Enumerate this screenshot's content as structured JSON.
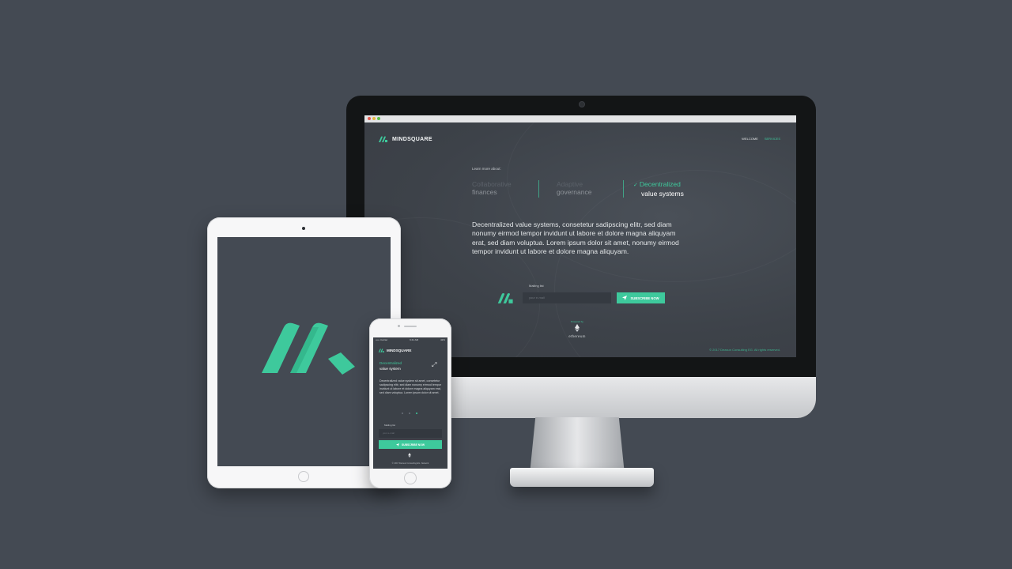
{
  "brand": {
    "name": "MINDSQUARE",
    "accent": "#3ec99c",
    "background": "#444a53"
  },
  "browser": {
    "dots": [
      "#e25b50",
      "#e7b63f",
      "#5cbf48"
    ]
  },
  "desktop": {
    "nav": {
      "welcome": "WELCOME",
      "services": "SERVICES"
    },
    "learn_more": "Learn more about:",
    "topics": [
      {
        "line1": "Collaborative",
        "line2": "finances",
        "active": false
      },
      {
        "line1": "Adaptive",
        "line2": "governance",
        "active": false
      },
      {
        "line1": "Decentralized",
        "line2": "value systems",
        "active": true
      }
    ],
    "description": "Decentralized value systems, consetetur sadipscing elitr, sed diam nonumy eirmod tempor invidunt ut labore et dolore magna aliquyam erat, sed diam voluptua. Lorem ipsum dolor sit amet, nonumy eirmod tempor invidunt ut labore et dolore magna aliquyam.",
    "mailing_list_label": "Mailing list",
    "email_placeholder": "your e-mail",
    "subscribe_label": "SUBSCRIBE NOW",
    "powered_by": "Powered by",
    "ethereum": "ethereum",
    "copyright": "© 2017 Dezaun Consulting EG. All rights reserved."
  },
  "phone": {
    "status": {
      "carrier": "••••• Carrier",
      "time": "9:41 AM",
      "battery": "42%"
    },
    "topic_line1": "Decentralized",
    "topic_line2": "value system",
    "description": "Decentralized value system sit amet, consetetur sadipscing elitr, sed diam nonumy eirmod tempor invidunt ut labore et dolore magna aliquyam erat, sed diam voluptua. Lorem ipsum dolor sit amet.",
    "mailing_list_label": "Mailing list",
    "email_placeholder": "your e-mail",
    "subscribe_label": "SUBSCRIBE NOW",
    "copyright": "© 2017 Dezaun Consulting EG. Network"
  }
}
